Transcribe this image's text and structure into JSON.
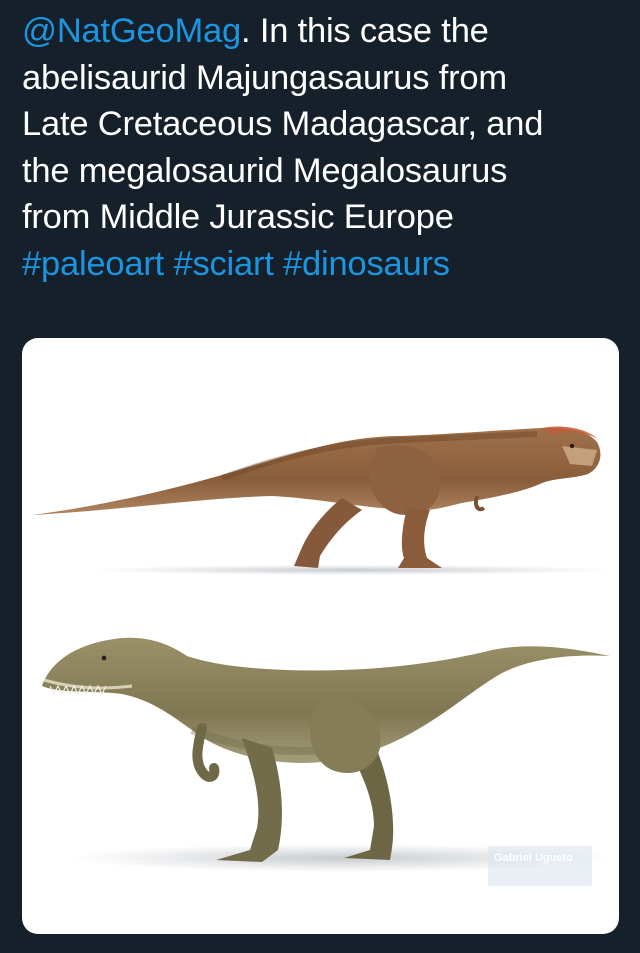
{
  "tweet": {
    "mention": "@NatGeoMag",
    "line1_rest": ". In this case the",
    "line2": "abelisaurid Majungasaurus from",
    "line3": "Late Cretaceous Madagascar, and",
    "line4": "the megalosaurid Megalosaurus",
    "line5": "from Middle Jurassic Europe",
    "hashtags": [
      "#paleoart",
      "#sciart",
      "#dinosaurs"
    ]
  },
  "media": {
    "artist_credit": "Gabriel Ugueto",
    "colors": {
      "background": "#15202b",
      "link": "#1b95e0",
      "card": "#ffffff"
    }
  }
}
